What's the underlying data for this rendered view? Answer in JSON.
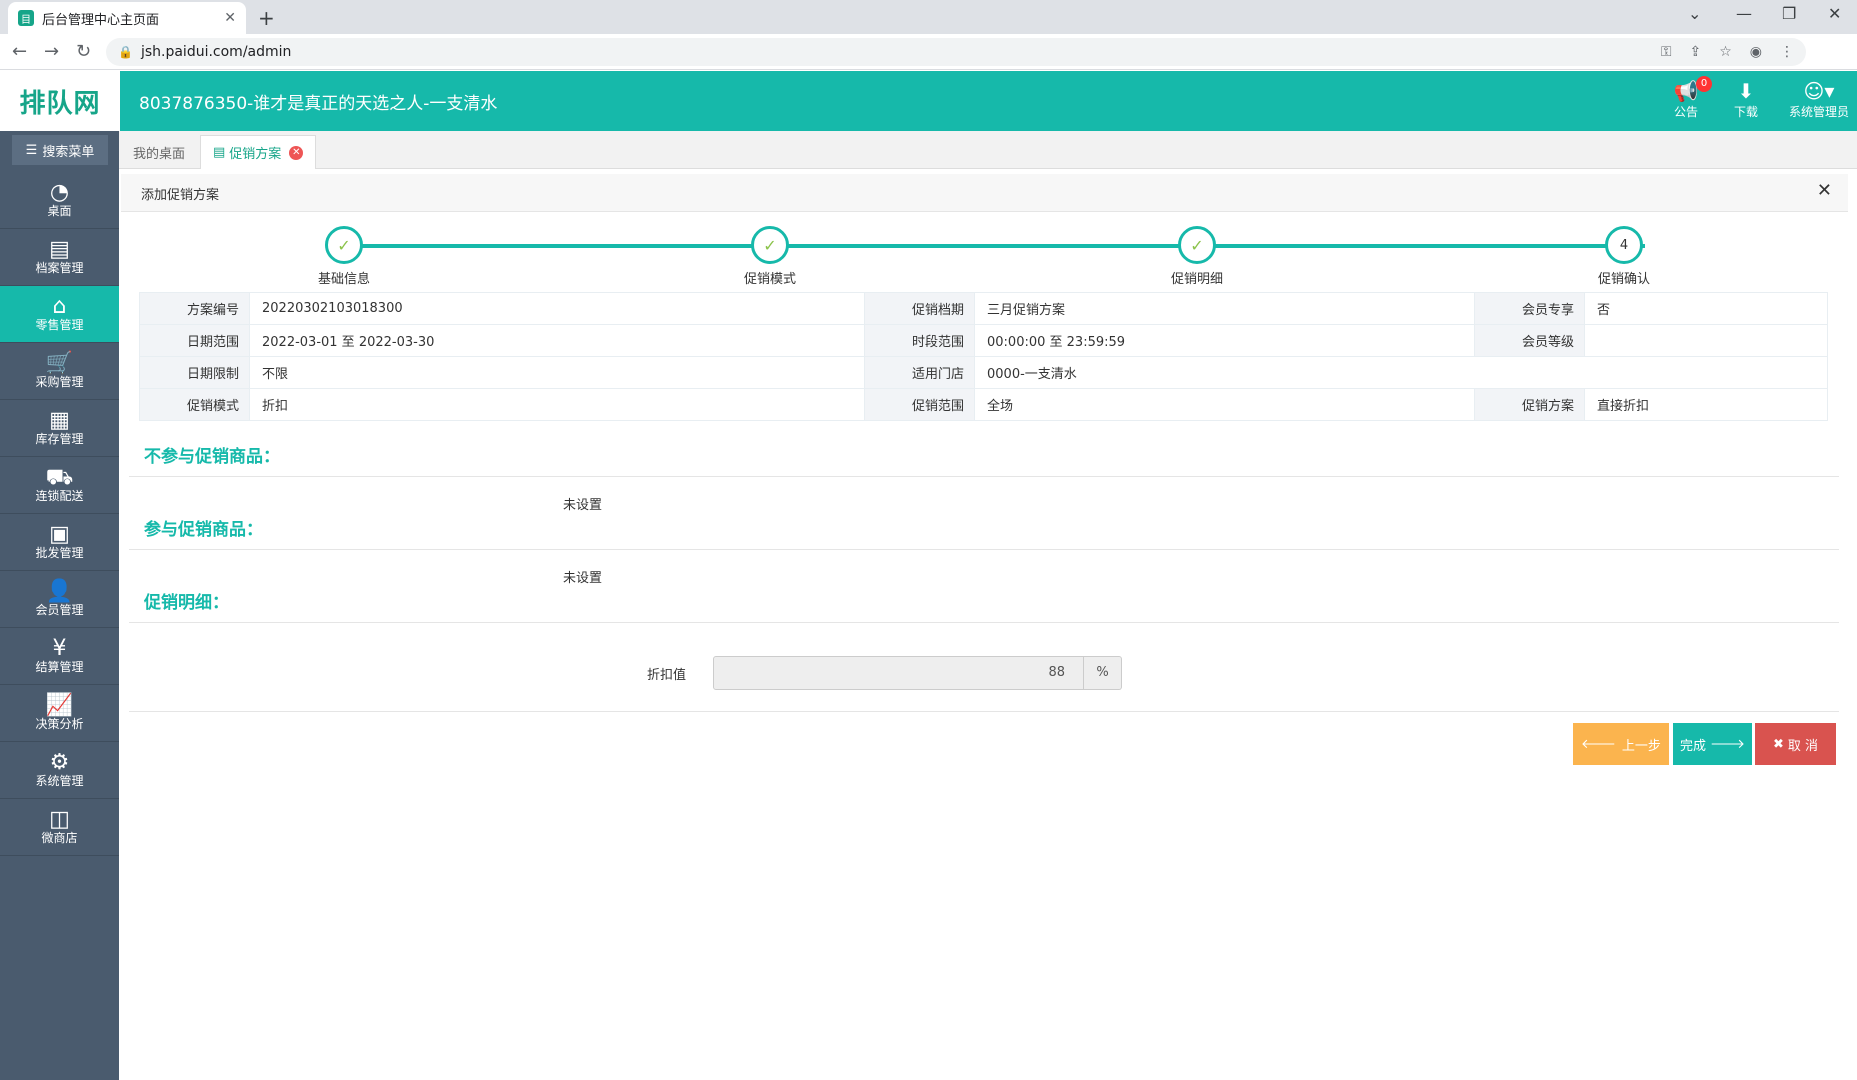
{
  "browser": {
    "tab_title": "后台管理中心主页面",
    "url": "jsh.paidui.com/admin"
  },
  "header": {
    "logo_text": "排队网",
    "shop_name": "8037876350-谁才是真正的天选之人-一支清水",
    "notice_label": "公告",
    "notice_badge": "0",
    "download_label": "下载",
    "user_label": "系统管理员"
  },
  "sidebar": {
    "search_label": "搜索菜单",
    "items": [
      {
        "label": "桌面",
        "icon": "dashboard-icon"
      },
      {
        "label": "档案管理",
        "icon": "file-icon"
      },
      {
        "label": "零售管理",
        "icon": "store-icon"
      },
      {
        "label": "采购管理",
        "icon": "cart-icon"
      },
      {
        "label": "库存管理",
        "icon": "inventory-icon"
      },
      {
        "label": "连锁配送",
        "icon": "truck-icon"
      },
      {
        "label": "批发管理",
        "icon": "wholesale-icon"
      },
      {
        "label": "会员管理",
        "icon": "member-icon"
      },
      {
        "label": "结算管理",
        "icon": "settlement-icon"
      },
      {
        "label": "决策分析",
        "icon": "chart-icon"
      },
      {
        "label": "系统管理",
        "icon": "gear-icon"
      },
      {
        "label": "微商店",
        "icon": "bag-icon"
      }
    ]
  },
  "tabs": {
    "desk": "我的桌面",
    "promo": "促销方案"
  },
  "panel": {
    "title": "添加促销方案"
  },
  "steps": [
    {
      "label": "基础信息",
      "done": true
    },
    {
      "label": "促销模式",
      "done": true
    },
    {
      "label": "促销明细",
      "done": true
    },
    {
      "label": "促销确认",
      "num": "4"
    }
  ],
  "info": {
    "r1": {
      "k1": "方案编号",
      "v1": "20220302103018300",
      "k2": "促销档期",
      "v2": "三月促销方案",
      "k3": "会员专享",
      "v3": "否"
    },
    "r2": {
      "k1": "日期范围",
      "v1": "2022-03-01 至 2022-03-30",
      "k2": "时段范围",
      "v2": "00:00:00 至 23:59:59",
      "k3": "会员等级",
      "v3": ""
    },
    "r3": {
      "k1": "日期限制",
      "v1": "不限",
      "k2": "适用门店",
      "v2": "0000-一支清水"
    },
    "r4": {
      "k1": "促销模式",
      "v1": "折扣",
      "k2": "促销范围",
      "v2": "全场",
      "k3": "促销方案",
      "v3": "直接折扣"
    }
  },
  "sections": {
    "excluded": "不参与促销商品：",
    "excluded_value": "未设置",
    "included": "参与促销商品：",
    "included_value": "未设置",
    "detail": "促销明细："
  },
  "discount": {
    "label": "折扣值",
    "value": "88",
    "unit": "%"
  },
  "buttons": {
    "prev": "上一步",
    "done": "完成",
    "cancel": "取 消"
  }
}
